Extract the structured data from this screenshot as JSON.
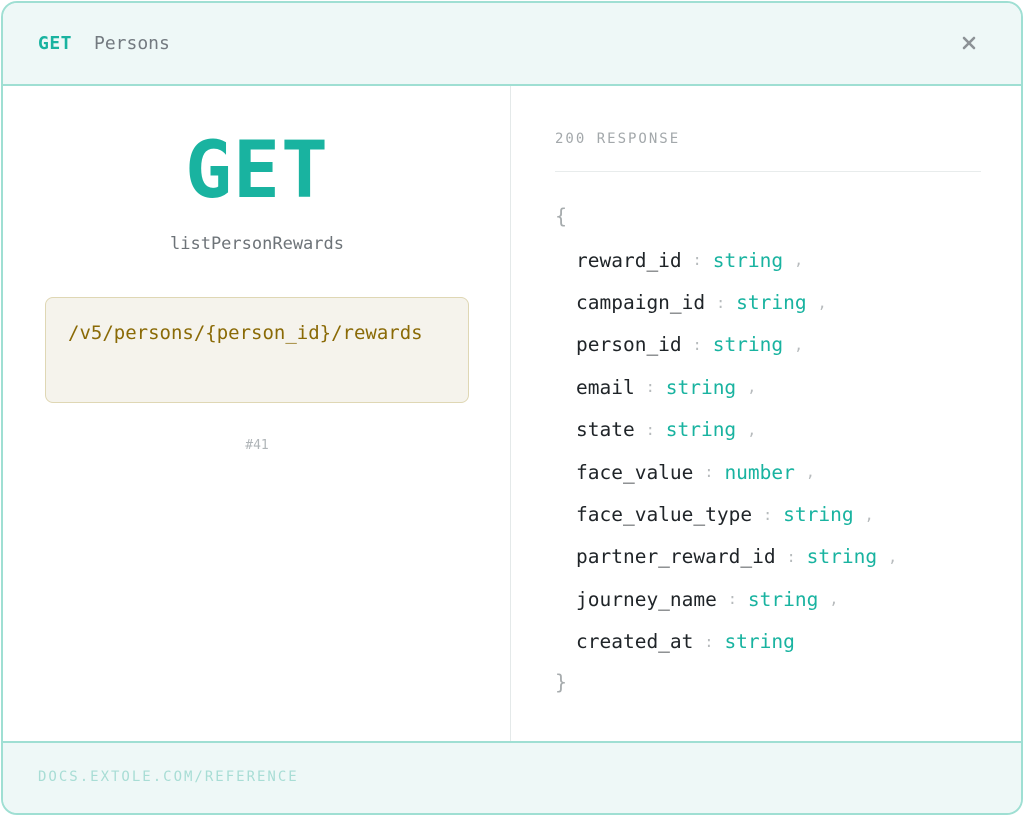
{
  "header": {
    "method": "GET",
    "title": "Persons",
    "close_icon": "close-icon"
  },
  "endpoint": {
    "method": "GET",
    "operation_id": "listPersonRewards",
    "path": "/v5/persons/{person_id}/rewards",
    "index": "#41"
  },
  "response": {
    "label": "200 RESPONSE",
    "open_brace": "{",
    "close_brace": "}",
    "fields": [
      {
        "name": "reward_id",
        "type": "string"
      },
      {
        "name": "campaign_id",
        "type": "string"
      },
      {
        "name": "person_id",
        "type": "string"
      },
      {
        "name": "email",
        "type": "string"
      },
      {
        "name": "state",
        "type": "string"
      },
      {
        "name": "face_value",
        "type": "number"
      },
      {
        "name": "face_value_type",
        "type": "string"
      },
      {
        "name": "partner_reward_id",
        "type": "string"
      },
      {
        "name": "journey_name",
        "type": "string"
      },
      {
        "name": "created_at",
        "type": "string"
      }
    ]
  },
  "footer": {
    "link_text": "DOCS.EXTOLE.COM/REFERENCE"
  },
  "colors": {
    "accent": "#19b3a0",
    "path_text": "#8a6a06",
    "border": "#9fdfd3"
  }
}
